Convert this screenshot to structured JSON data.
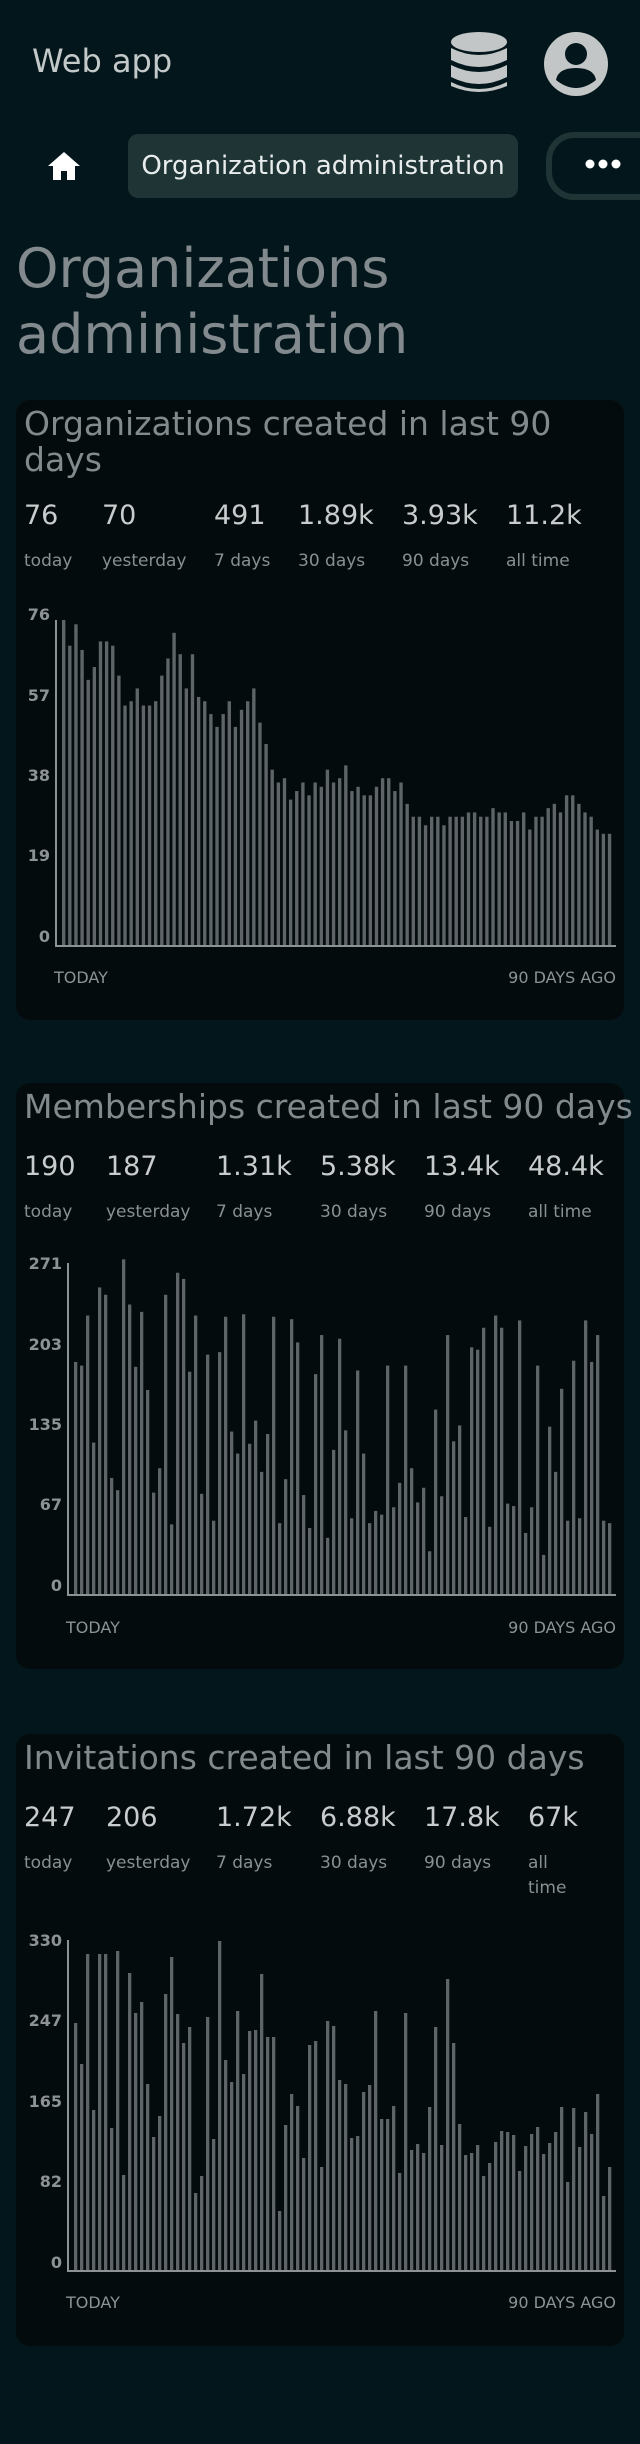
{
  "app": {
    "title": "Web app"
  },
  "icons": {
    "database": "database-icon",
    "account": "account-circle-icon",
    "home": "home-icon",
    "more": "more-horizontal-icon"
  },
  "nav": {
    "active_tab": "Organization administration"
  },
  "page": {
    "title": "Organizations administration"
  },
  "cards": [
    {
      "title": "Organizations created in last 90 days",
      "stats": [
        {
          "value": "76",
          "label": "today"
        },
        {
          "value": "70",
          "label": "yesterday"
        },
        {
          "value": "491",
          "label": "7 days"
        },
        {
          "value": "1.89k",
          "label": "30 days"
        },
        {
          "value": "3.93k",
          "label": "90 days"
        },
        {
          "value": "11.2k",
          "label": "all time"
        }
      ],
      "x_start_label": "TODAY",
      "x_end_label": "90 DAYS AGO",
      "y_ticks": [
        "76",
        "57",
        "38",
        "19",
        "0"
      ]
    },
    {
      "title": "Memberships created in last 90 days",
      "stats": [
        {
          "value": "190",
          "label": "today"
        },
        {
          "value": "187",
          "label": "yesterday"
        },
        {
          "value": "1.31k",
          "label": "7 days"
        },
        {
          "value": "5.38k",
          "label": "30 days"
        },
        {
          "value": "13.4k",
          "label": "90 days"
        },
        {
          "value": "48.4k",
          "label": "all time"
        }
      ],
      "x_start_label": "TODAY",
      "x_end_label": "90 DAYS AGO",
      "y_ticks": [
        "271",
        "203",
        "135",
        "67",
        "0"
      ]
    },
    {
      "title": "Invitations created in last 90 days",
      "stats": [
        {
          "value": "247",
          "label": "today"
        },
        {
          "value": "206",
          "label": "yesterday"
        },
        {
          "value": "1.72k",
          "label": "7 days"
        },
        {
          "value": "6.88k",
          "label": "30 days"
        },
        {
          "value": "17.8k",
          "label": "90 days"
        },
        {
          "value": "67k",
          "label": "all time"
        }
      ],
      "x_start_label": "TODAY",
      "x_end_label": "90 DAYS AGO",
      "y_ticks": [
        "330",
        "247",
        "165",
        "82",
        "0"
      ]
    }
  ],
  "chart_data": [
    {
      "type": "bar",
      "ylim": [
        0,
        76
      ],
      "values": [
        76,
        70,
        75,
        69,
        62,
        65,
        71,
        71,
        70,
        63,
        56,
        57,
        60,
        56,
        56,
        57,
        63,
        67,
        73,
        68,
        60,
        68,
        58,
        57,
        54,
        51,
        54,
        57,
        51,
        55,
        57,
        60,
        52,
        47,
        41,
        38,
        39,
        34,
        36,
        38,
        35,
        38,
        37,
        41,
        38,
        39,
        42,
        36,
        37,
        35,
        35,
        37,
        39,
        39,
        36,
        38,
        33,
        30,
        30,
        28,
        30,
        30,
        28,
        30,
        30,
        30,
        31,
        31,
        30,
        30,
        32,
        31,
        31,
        29,
        29,
        31,
        27,
        30,
        30,
        32,
        33,
        31,
        35,
        35,
        33,
        31,
        30,
        27,
        26,
        26
      ]
    },
    {
      "type": "bar",
      "ylim": [
        0,
        271
      ],
      "values": [
        190,
        187,
        228,
        124,
        251,
        245,
        95,
        85,
        274,
        237,
        186,
        231,
        167,
        83,
        103,
        245,
        57,
        263,
        258,
        182,
        228,
        82,
        196,
        60,
        198,
        227,
        133,
        115,
        229,
        123,
        142,
        100,
        131,
        227,
        58,
        94,
        225,
        206,
        81,
        54,
        180,
        212,
        46,
        118,
        209,
        134,
        62,
        183,
        115,
        58,
        68,
        65,
        187,
        71,
        91,
        187,
        103,
        75,
        87,
        35,
        151,
        80,
        212,
        125,
        138,
        63,
        202,
        200,
        218,
        55,
        228,
        218,
        74,
        72,
        224,
        50,
        71,
        187,
        32,
        137,
        100,
        168,
        60,
        191,
        62,
        224,
        190,
        212,
        60,
        58
      ]
    },
    {
      "type": "bar",
      "ylim": [
        0,
        330
      ],
      "values": [
        247,
        206,
        316,
        160,
        316,
        316,
        142,
        319,
        95,
        297,
        257,
        268,
        186,
        133,
        154,
        276,
        313,
        256,
        227,
        243,
        77,
        94,
        253,
        131,
        329,
        210,
        188,
        259,
        196,
        239,
        240,
        296,
        233,
        233,
        59,
        145,
        176,
        164,
        112,
        225,
        229,
        103,
        249,
        244,
        190,
        186,
        132,
        134,
        178,
        185,
        259,
        151,
        151,
        164,
        97,
        257,
        120,
        126,
        117,
        163,
        243,
        125,
        291,
        227,
        146,
        115,
        117,
        125,
        94,
        107,
        128,
        139,
        138,
        135,
        99,
        124,
        136,
        143,
        116,
        127,
        138,
        163,
        88,
        162,
        123,
        158,
        136,
        176,
        74,
        103
      ]
    }
  ]
}
